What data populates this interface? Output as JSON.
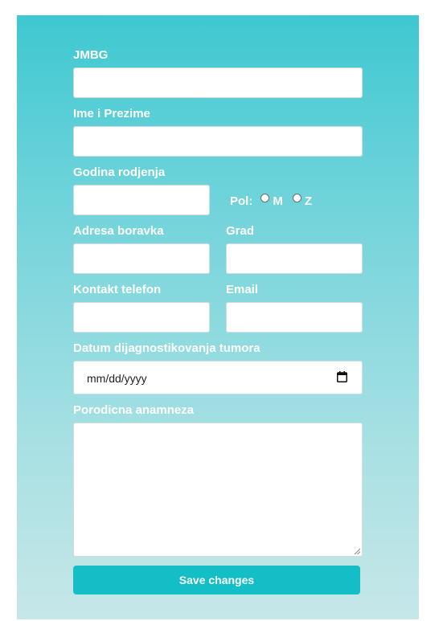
{
  "form": {
    "jmbg": {
      "label": "JMBG",
      "value": ""
    },
    "full_name": {
      "label": "Ime i Prezime",
      "value": ""
    },
    "birth_year": {
      "label": "Godina rodjenja",
      "value": ""
    },
    "sex": {
      "label": "Pol:",
      "options": [
        "M",
        "Z"
      ],
      "selected": null
    },
    "address": {
      "label": "Adresa boravka",
      "value": ""
    },
    "city": {
      "label": "Grad",
      "value": ""
    },
    "phone": {
      "label": "Kontakt telefon",
      "value": ""
    },
    "email": {
      "label": "Email",
      "value": ""
    },
    "diagnosis_date": {
      "label": "Datum dijagnostikovanja tumora",
      "placeholder": "mm/dd/yyyy"
    },
    "family_history": {
      "label": "Porodicna anamneza",
      "value": ""
    },
    "save_label": "Save changes"
  },
  "colors": {
    "panel_top": "#3ec8d1",
    "panel_bottom": "#c7e7e8",
    "button": "#13bec6"
  }
}
